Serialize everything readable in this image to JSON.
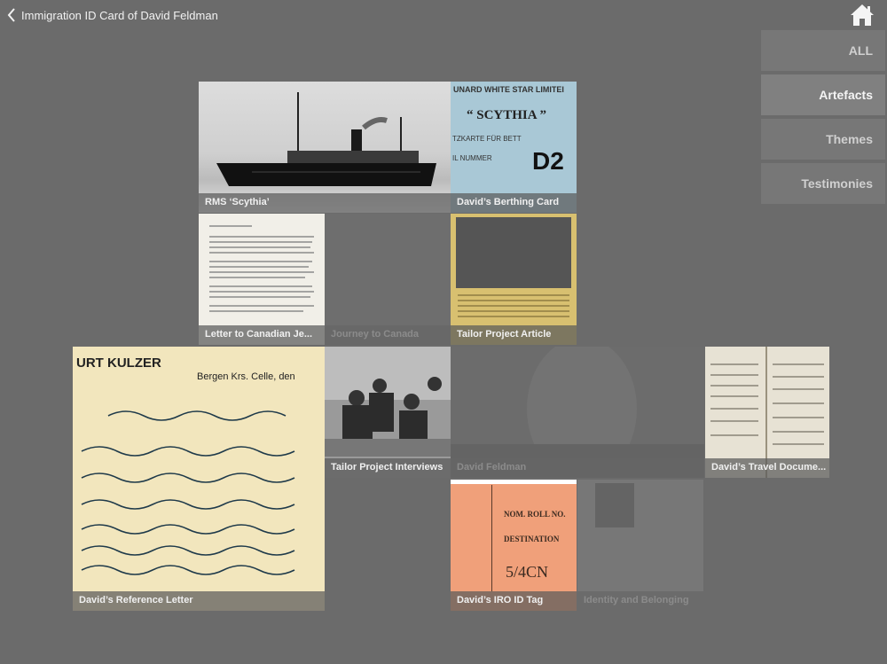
{
  "header": {
    "title": "Immigration ID Card of David Feldman"
  },
  "filters": [
    {
      "label": "ALL",
      "active": false
    },
    {
      "label": "Artefacts",
      "active": true
    },
    {
      "label": "Themes",
      "active": false
    },
    {
      "label": "Testimonies",
      "active": false
    }
  ],
  "tiles": [
    {
      "caption": "RMS ‘Scythia’",
      "dimmed": false
    },
    {
      "caption": "David’s Berthing Card",
      "dimmed": false
    },
    {
      "caption": "Letter to Canadian Je...",
      "dimmed": false
    },
    {
      "caption": "Journey to Canada",
      "dimmed": true
    },
    {
      "caption": "Tailor Project Article",
      "dimmed": false
    },
    {
      "caption": "David’s Reference Letter",
      "dimmed": false
    },
    {
      "caption": "Tailor Project Interviews",
      "dimmed": false
    },
    {
      "caption": "David Feldman",
      "dimmed": true
    },
    {
      "caption": "David’s Travel Docume...",
      "dimmed": false
    },
    {
      "caption": "David’s IRO ID Tag",
      "dimmed": false
    },
    {
      "caption": "Identity and Belonging",
      "dimmed": true
    }
  ],
  "artefact_text": {
    "berthing_line1": "UNARD WHITE STAR LIMITEI",
    "berthing_ship": "“ SCYTHIA ”",
    "berthing_line2": "TZKARTE FÜR BETT",
    "berthing_line3": "IL NUMMER",
    "berthing_code": "D2",
    "reference_header": "URT KULZER",
    "reference_place": "Bergen Krs. Celle, den",
    "tag_roll": "NOM. ROLL NO.",
    "tag_dest": "DESTINATION",
    "tag_code": "5/4CN"
  },
  "colors": {
    "background": "#6b6b6b",
    "filter_active": "#808080",
    "filter_inactive": "#777777"
  }
}
